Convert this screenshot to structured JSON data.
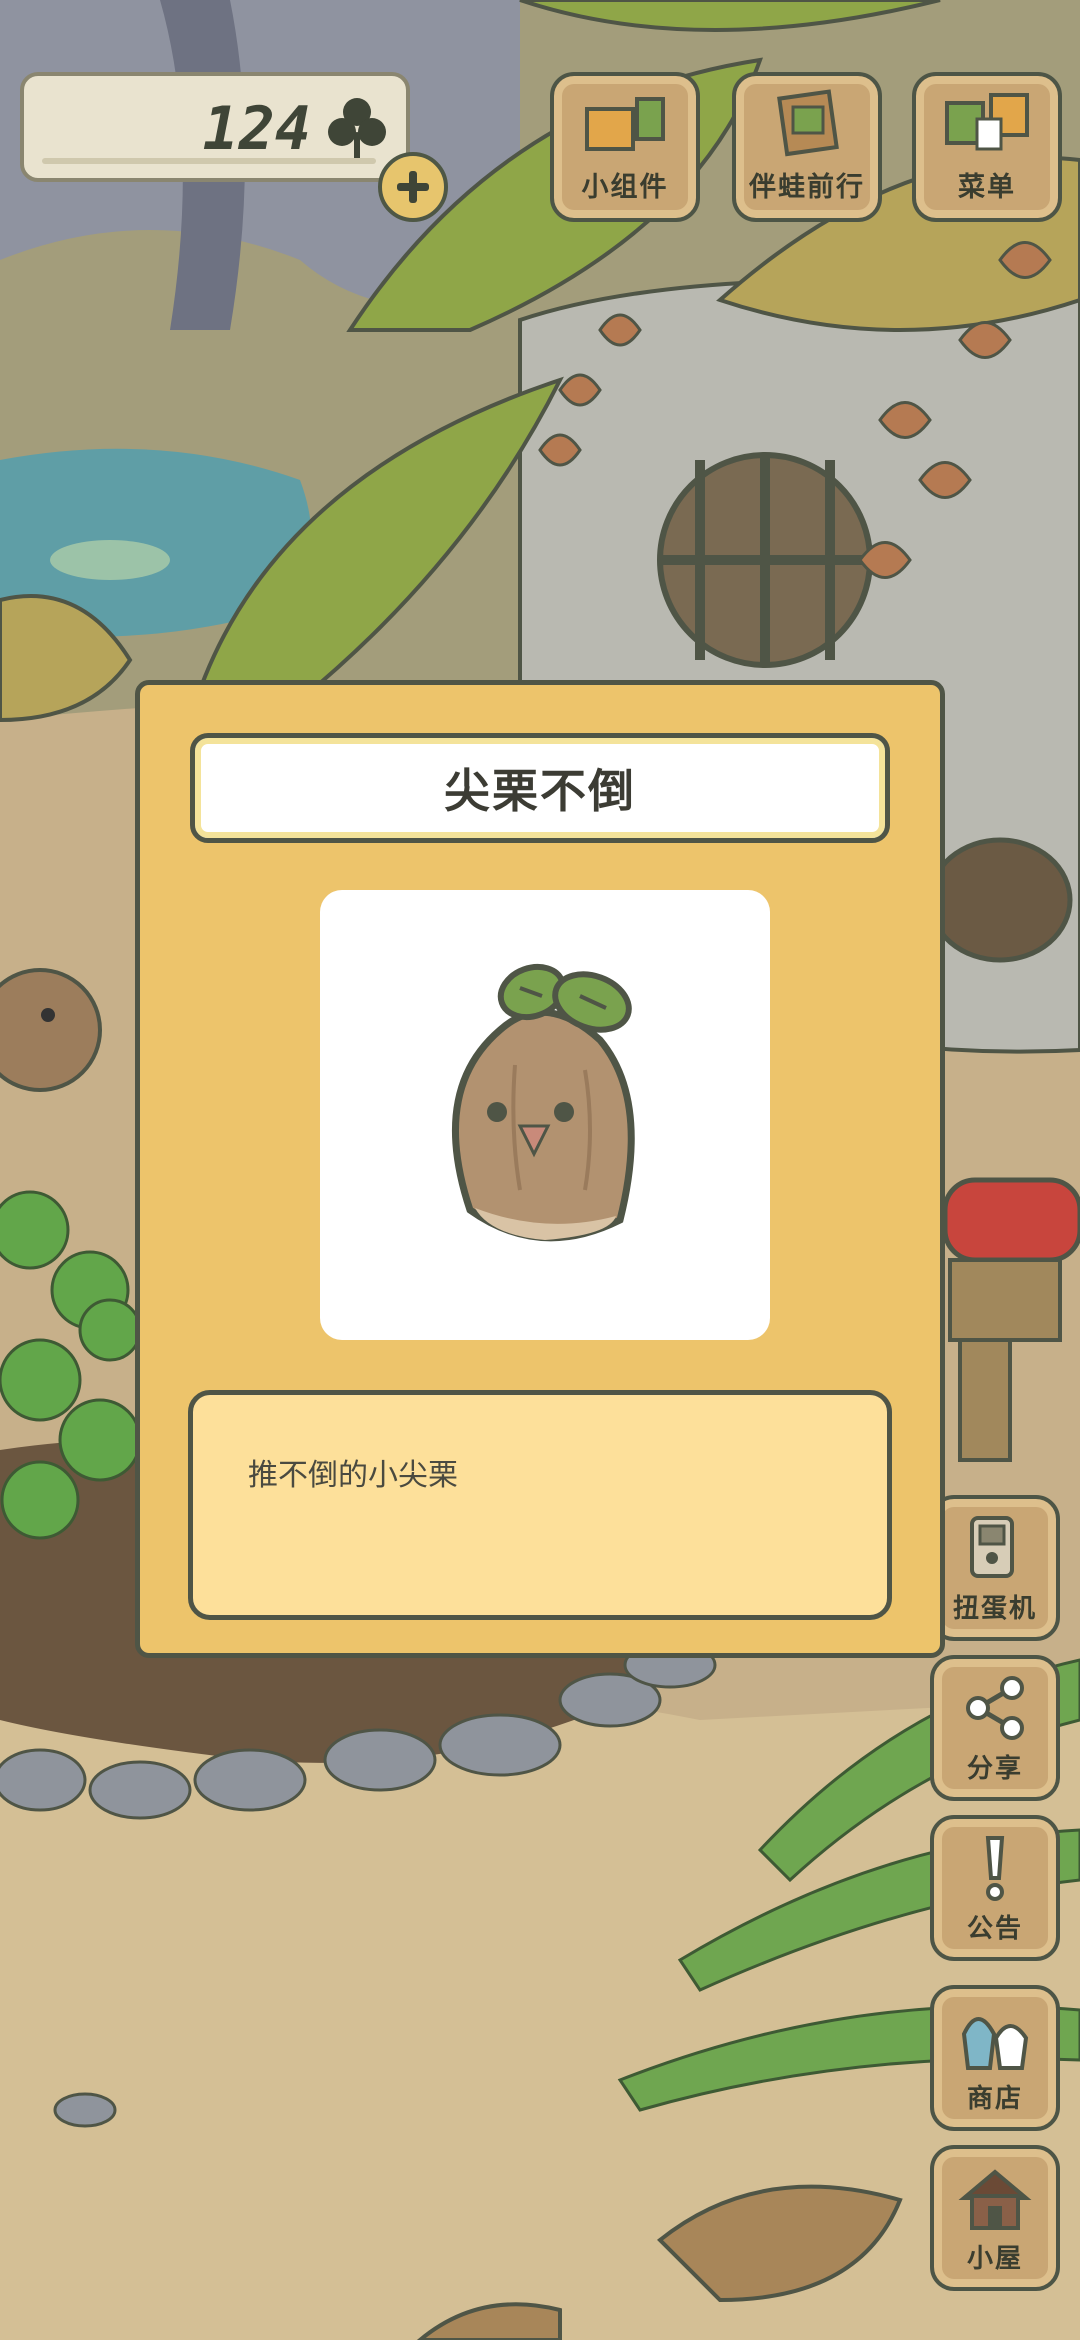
{
  "currency": {
    "clover_count": "124",
    "icon": "clover-icon",
    "add_icon": "plus-icon"
  },
  "top_menu": [
    {
      "label": "小组件",
      "icon": "widget-icon"
    },
    {
      "label": "伴蛙前行",
      "icon": "frog-journey-icon"
    },
    {
      "label": "菜单",
      "icon": "menu-cards-icon"
    }
  ],
  "side_menu": [
    {
      "label": "扭蛋机",
      "icon": "gacha-machine-icon"
    },
    {
      "label": "分享",
      "icon": "share-icon"
    },
    {
      "label": "公告",
      "icon": "notice-icon"
    },
    {
      "label": "商店",
      "icon": "shop-bags-icon"
    },
    {
      "label": "小屋",
      "icon": "house-icon"
    }
  ],
  "item_dialog": {
    "title": "尖栗不倒",
    "image_icon": "chestnut-roly-poly-icon",
    "description": "推不倒的小尖栗"
  },
  "colors": {
    "dialog_bg": "#edc46b",
    "dialog_border": "#4f5546",
    "desc_bg": "#fde09a",
    "button_wood": "#c9a674"
  }
}
